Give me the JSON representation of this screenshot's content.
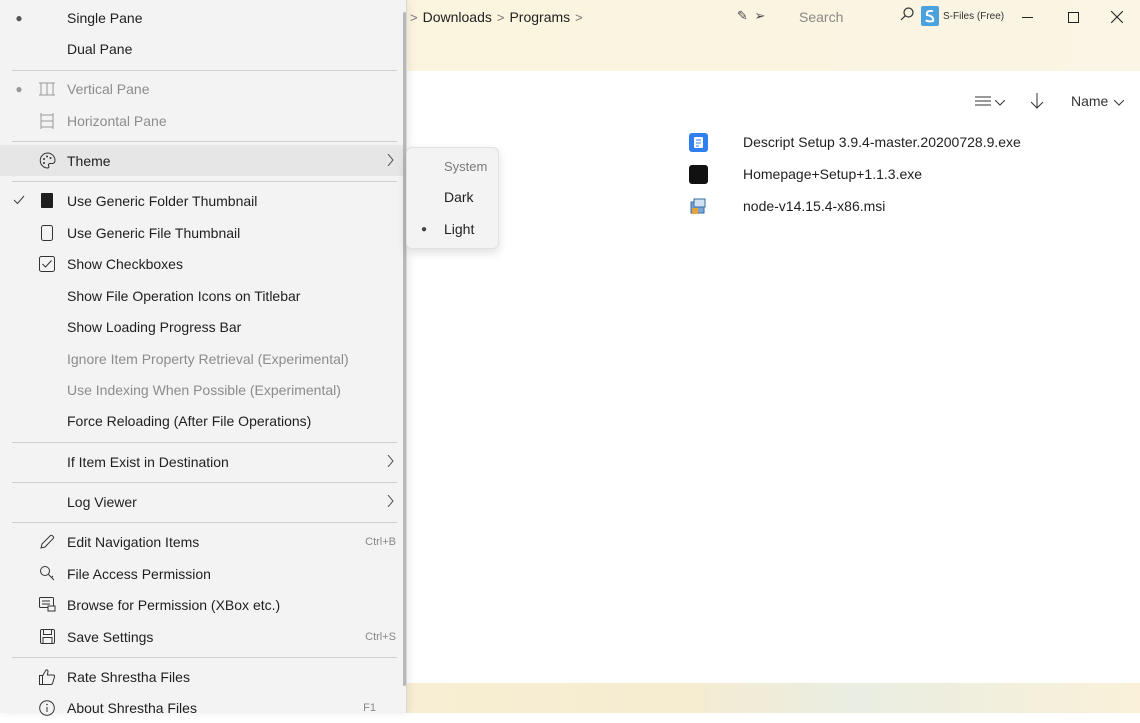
{
  "titlebar": {
    "breadcrumb": [
      "Downloads",
      "Programs"
    ],
    "search_placeholder": "Search",
    "app_title": "S-Files (Free)"
  },
  "toolbar": {
    "sort_label": "Name"
  },
  "files": [
    {
      "name": "Descript Setup 3.9.4-master.20200728.9.exe",
      "icon_color": "#2f7ff0"
    },
    {
      "name": "Homepage+Setup+1.1.3.exe",
      "icon_color": "#111111"
    },
    {
      "name": "node-v14.15.4-x86.msi",
      "icon_color": "#4a7bb7"
    }
  ],
  "menu": {
    "single_pane": "Single Pane",
    "dual_pane": "Dual Pane",
    "vertical_pane": "Vertical Pane",
    "horizontal_pane": "Horizontal Pane",
    "theme": "Theme",
    "generic_folder_thumb": "Use Generic Folder Thumbnail",
    "generic_file_thumb": "Use Generic File Thumbnail",
    "show_checkboxes": "Show Checkboxes",
    "file_op_icons": "Show File Operation Icons on Titlebar",
    "loading_bar": "Show Loading Progress Bar",
    "ignore_prop": "Ignore Item Property Retrieval (Experimental)",
    "use_indexing": "Use Indexing When Possible (Experimental)",
    "force_reload": "Force Reloading (After File Operations)",
    "if_exist": "If Item Exist in Destination",
    "log_viewer": "Log Viewer",
    "edit_nav": "Edit Navigation Items",
    "edit_nav_shortcut": "Ctrl+B",
    "file_access": "File Access Permission",
    "browse_perm": "Browse for Permission (XBox etc.)",
    "save_settings": "Save Settings",
    "save_shortcut": "Ctrl+S",
    "rate": "Rate Shrestha Files",
    "about": "About Shrestha Files",
    "about_shortcut": "F1"
  },
  "theme_submenu": {
    "system": "System",
    "dark": "Dark",
    "light": "Light"
  }
}
